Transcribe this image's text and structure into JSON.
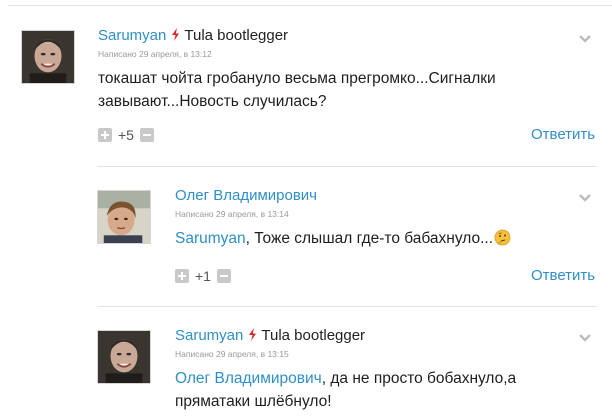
{
  "comments": [
    {
      "author": "Sarumyan",
      "group": "Tula bootlegger",
      "meta": "Написано 29 апреля, в 13:12",
      "text": "токашат чойта гробануло весьма прегромко...Сигналки завывают...Новость случилась?",
      "votes": "+5",
      "reply_label": "Ответить",
      "avatar_icon": "user-photo-bald-man"
    },
    {
      "author": "Олег Владимирович",
      "meta": "Написано 29 апреля, в 13:14",
      "mention": "Sarumyan",
      "text": ", Тоже слышал где-то бабахнуло...",
      "emoji_icon": "thinking-face-emoji",
      "votes": "+1",
      "reply_label": "Ответить",
      "avatar_icon": "user-photo-webcam"
    },
    {
      "author": "Sarumyan",
      "group": "Tula bootlegger",
      "meta": "Написано 29 апреля, в 13:15",
      "mention": "Олег Владимирович",
      "text_line1": ", да не просто бобахнуло,а",
      "text_line2": "пряматаки шлёбнуло!",
      "avatar_icon": "user-photo-bald-man"
    }
  ],
  "colors": {
    "link": "#2f8fc6",
    "bolt": "#d9262c",
    "divider": "#e4e4e4"
  }
}
